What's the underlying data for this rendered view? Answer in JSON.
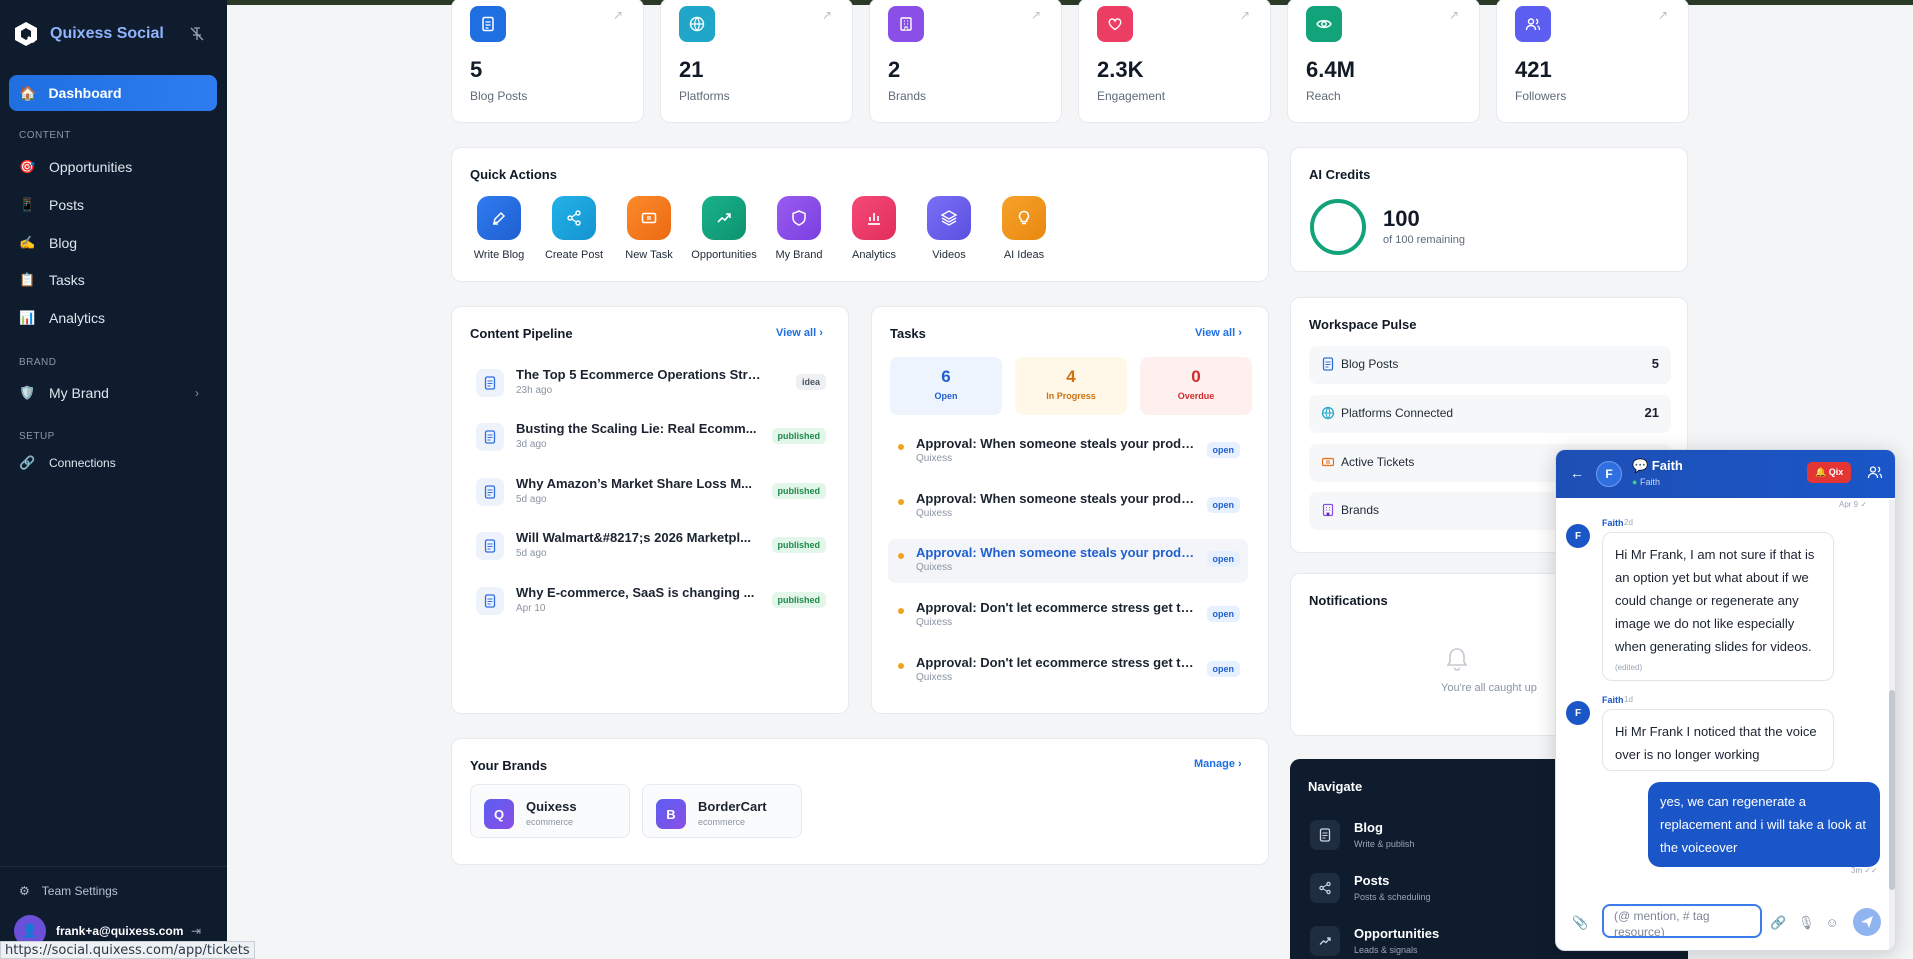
{
  "app": {
    "name": "Quixess Social"
  },
  "sidebar": {
    "dashboard": "Dashboard",
    "sections": {
      "content": "CONTENT",
      "brand": "BRAND",
      "setup": "SETUP"
    },
    "items": [
      {
        "label": "Opportunities",
        "icon": "target-icon"
      },
      {
        "label": "Posts",
        "icon": "phone-icon"
      },
      {
        "label": "Blog",
        "icon": "writing-hand-icon"
      },
      {
        "label": "Tasks",
        "icon": "clipboard-icon"
      },
      {
        "label": "Analytics",
        "icon": "chart-icon"
      }
    ],
    "my_brand": "My Brand",
    "connections": "Connections",
    "team_settings": "Team Settings",
    "user_email": "frank+a@quixess.com"
  },
  "status_url": "https://social.quixess.com/app/tickets",
  "stats": [
    {
      "value": "5",
      "label": "Blog Posts",
      "color": "#1f6fe0"
    },
    {
      "value": "21",
      "label": "Platforms",
      "color": "#1fa6c9"
    },
    {
      "value": "2",
      "label": "Brands",
      "color": "#8a4fe6"
    },
    {
      "value": "2.3K",
      "label": "Engagement",
      "color": "#ec3d62"
    },
    {
      "value": "6.4M",
      "label": "Reach",
      "color": "#12a37a"
    },
    {
      "value": "421",
      "label": "Followers",
      "color": "#5b5ef0"
    }
  ],
  "quick_actions": {
    "title": "Quick Actions",
    "items": [
      "Write Blog",
      "Create Post",
      "New Task",
      "Opportunities",
      "My Brand",
      "Analytics",
      "Videos",
      "AI Ideas"
    ]
  },
  "ai_credits": {
    "title": "AI Credits",
    "value": "100",
    "sub": "of 100 remaining"
  },
  "pipeline": {
    "title": "Content Pipeline",
    "view_all": "View all",
    "items": [
      {
        "title": "The Top 5 Ecommerce Operations Strea...",
        "date": "23h ago",
        "status": "idea"
      },
      {
        "title": "Busting the Scaling Lie: Real Ecomm...",
        "date": "3d ago",
        "status": "published"
      },
      {
        "title": "Why Amazon’s Market Share Loss M...",
        "date": "5d ago",
        "status": "published"
      },
      {
        "title": "Will Walmart&#8217;s 2026 Marketpl...",
        "date": "5d ago",
        "status": "published"
      },
      {
        "title": "Why E-commerce, SaaS is changing ...",
        "date": "Apr 10",
        "status": "published"
      }
    ]
  },
  "tasks": {
    "title": "Tasks",
    "view_all": "View all",
    "counts": [
      {
        "value": "6",
        "label": "Open"
      },
      {
        "value": "4",
        "label": "In Progress"
      },
      {
        "value": "0",
        "label": "Overdue"
      }
    ],
    "items": [
      {
        "title": "Approval: When someone steals your produ...",
        "sub": "Quixess",
        "status": "open"
      },
      {
        "title": "Approval: When someone steals your produ...",
        "sub": "Quixess",
        "status": "open"
      },
      {
        "title": "Approval: When someone steals your produ...",
        "sub": "Quixess",
        "status": "open"
      },
      {
        "title": "Approval: Don't let ecommerce stress get th...",
        "sub": "Quixess",
        "status": "open"
      },
      {
        "title": "Approval: Don't let ecommerce stress get th...",
        "sub": "Quixess",
        "status": "open"
      }
    ]
  },
  "workspace_pulse": {
    "title": "Workspace Pulse",
    "items": [
      {
        "label": "Blog Posts",
        "value": "5"
      },
      {
        "label": "Platforms Connected",
        "value": "21"
      },
      {
        "label": "Active Tickets",
        "value": ""
      },
      {
        "label": "Brands",
        "value": ""
      }
    ]
  },
  "notifications": {
    "title": "Notifications",
    "empty": "You're all caught up"
  },
  "brands": {
    "title": "Your Brands",
    "manage": "Manage",
    "items": [
      {
        "initial": "Q",
        "name": "Quixess",
        "sub": "ecommerce"
      },
      {
        "initial": "B",
        "name": "BorderCart",
        "sub": "ecommerce"
      }
    ]
  },
  "navigate": {
    "title": "Navigate",
    "items": [
      {
        "title": "Blog",
        "sub": "Write & publish"
      },
      {
        "title": "Posts",
        "sub": "Posts & scheduling"
      },
      {
        "title": "Opportunities",
        "sub": "Leads & signals"
      }
    ]
  },
  "chat": {
    "name": "💬 Faith",
    "status": "Faith",
    "qix": "Qix",
    "top_time": "Apr 9",
    "messages": [
      {
        "author": "Faith",
        "initial": "F",
        "time": "2d",
        "text": "Hi Mr Frank, I am not sure if that is an option yet but what about if we could change or regenerate any image we do not like especially when generating slides for videos.",
        "edited": "(edited)"
      },
      {
        "author": "Faith",
        "initial": "F",
        "time": "1d",
        "text": "Hi Mr Frank I noticed that the voice over is no longer working"
      }
    ],
    "mine": {
      "text": "yes, we can regenerate a replacement and i will take a look at the voiceover",
      "time": "3m"
    },
    "input_placeholder": "(@ mention, # tag resource)"
  }
}
